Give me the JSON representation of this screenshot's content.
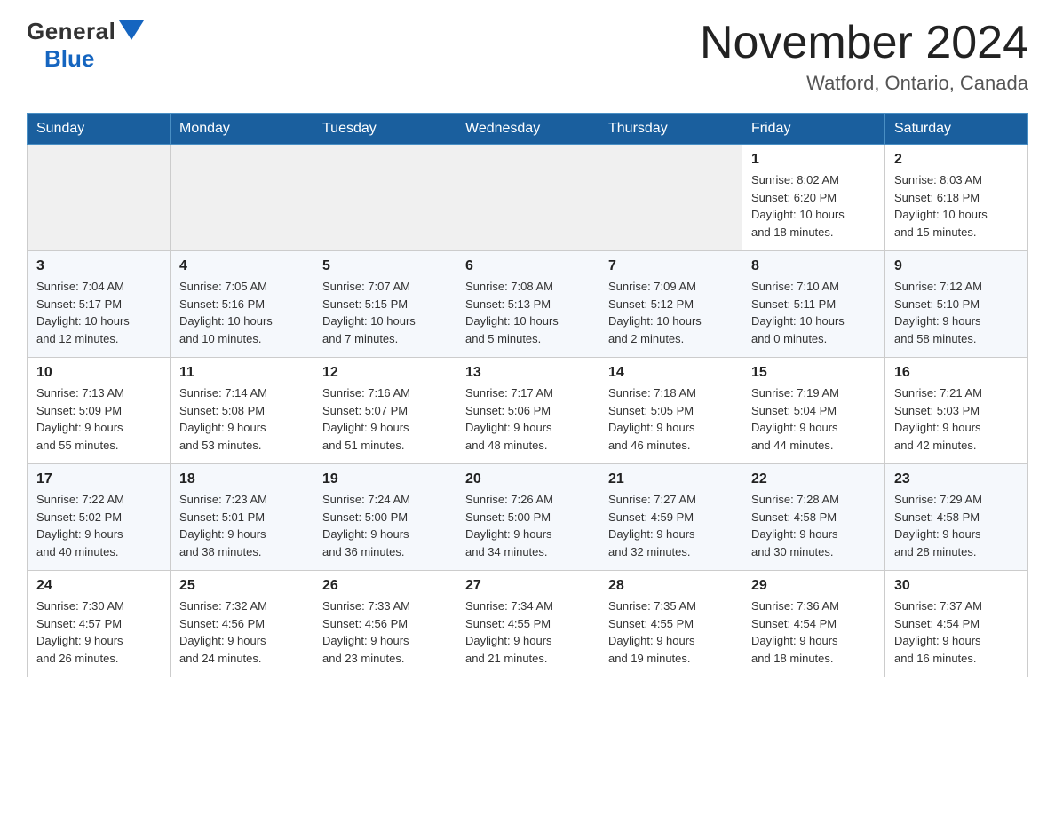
{
  "header": {
    "logo_general": "General",
    "logo_blue": "Blue",
    "month_title": "November 2024",
    "location": "Watford, Ontario, Canada"
  },
  "weekdays": [
    "Sunday",
    "Monday",
    "Tuesday",
    "Wednesday",
    "Thursday",
    "Friday",
    "Saturday"
  ],
  "weeks": [
    [
      {
        "day": "",
        "info": ""
      },
      {
        "day": "",
        "info": ""
      },
      {
        "day": "",
        "info": ""
      },
      {
        "day": "",
        "info": ""
      },
      {
        "day": "",
        "info": ""
      },
      {
        "day": "1",
        "info": "Sunrise: 8:02 AM\nSunset: 6:20 PM\nDaylight: 10 hours\nand 18 minutes."
      },
      {
        "day": "2",
        "info": "Sunrise: 8:03 AM\nSunset: 6:18 PM\nDaylight: 10 hours\nand 15 minutes."
      }
    ],
    [
      {
        "day": "3",
        "info": "Sunrise: 7:04 AM\nSunset: 5:17 PM\nDaylight: 10 hours\nand 12 minutes."
      },
      {
        "day": "4",
        "info": "Sunrise: 7:05 AM\nSunset: 5:16 PM\nDaylight: 10 hours\nand 10 minutes."
      },
      {
        "day": "5",
        "info": "Sunrise: 7:07 AM\nSunset: 5:15 PM\nDaylight: 10 hours\nand 7 minutes."
      },
      {
        "day": "6",
        "info": "Sunrise: 7:08 AM\nSunset: 5:13 PM\nDaylight: 10 hours\nand 5 minutes."
      },
      {
        "day": "7",
        "info": "Sunrise: 7:09 AM\nSunset: 5:12 PM\nDaylight: 10 hours\nand 2 minutes."
      },
      {
        "day": "8",
        "info": "Sunrise: 7:10 AM\nSunset: 5:11 PM\nDaylight: 10 hours\nand 0 minutes."
      },
      {
        "day": "9",
        "info": "Sunrise: 7:12 AM\nSunset: 5:10 PM\nDaylight: 9 hours\nand 58 minutes."
      }
    ],
    [
      {
        "day": "10",
        "info": "Sunrise: 7:13 AM\nSunset: 5:09 PM\nDaylight: 9 hours\nand 55 minutes."
      },
      {
        "day": "11",
        "info": "Sunrise: 7:14 AM\nSunset: 5:08 PM\nDaylight: 9 hours\nand 53 minutes."
      },
      {
        "day": "12",
        "info": "Sunrise: 7:16 AM\nSunset: 5:07 PM\nDaylight: 9 hours\nand 51 minutes."
      },
      {
        "day": "13",
        "info": "Sunrise: 7:17 AM\nSunset: 5:06 PM\nDaylight: 9 hours\nand 48 minutes."
      },
      {
        "day": "14",
        "info": "Sunrise: 7:18 AM\nSunset: 5:05 PM\nDaylight: 9 hours\nand 46 minutes."
      },
      {
        "day": "15",
        "info": "Sunrise: 7:19 AM\nSunset: 5:04 PM\nDaylight: 9 hours\nand 44 minutes."
      },
      {
        "day": "16",
        "info": "Sunrise: 7:21 AM\nSunset: 5:03 PM\nDaylight: 9 hours\nand 42 minutes."
      }
    ],
    [
      {
        "day": "17",
        "info": "Sunrise: 7:22 AM\nSunset: 5:02 PM\nDaylight: 9 hours\nand 40 minutes."
      },
      {
        "day": "18",
        "info": "Sunrise: 7:23 AM\nSunset: 5:01 PM\nDaylight: 9 hours\nand 38 minutes."
      },
      {
        "day": "19",
        "info": "Sunrise: 7:24 AM\nSunset: 5:00 PM\nDaylight: 9 hours\nand 36 minutes."
      },
      {
        "day": "20",
        "info": "Sunrise: 7:26 AM\nSunset: 5:00 PM\nDaylight: 9 hours\nand 34 minutes."
      },
      {
        "day": "21",
        "info": "Sunrise: 7:27 AM\nSunset: 4:59 PM\nDaylight: 9 hours\nand 32 minutes."
      },
      {
        "day": "22",
        "info": "Sunrise: 7:28 AM\nSunset: 4:58 PM\nDaylight: 9 hours\nand 30 minutes."
      },
      {
        "day": "23",
        "info": "Sunrise: 7:29 AM\nSunset: 4:58 PM\nDaylight: 9 hours\nand 28 minutes."
      }
    ],
    [
      {
        "day": "24",
        "info": "Sunrise: 7:30 AM\nSunset: 4:57 PM\nDaylight: 9 hours\nand 26 minutes."
      },
      {
        "day": "25",
        "info": "Sunrise: 7:32 AM\nSunset: 4:56 PM\nDaylight: 9 hours\nand 24 minutes."
      },
      {
        "day": "26",
        "info": "Sunrise: 7:33 AM\nSunset: 4:56 PM\nDaylight: 9 hours\nand 23 minutes."
      },
      {
        "day": "27",
        "info": "Sunrise: 7:34 AM\nSunset: 4:55 PM\nDaylight: 9 hours\nand 21 minutes."
      },
      {
        "day": "28",
        "info": "Sunrise: 7:35 AM\nSunset: 4:55 PM\nDaylight: 9 hours\nand 19 minutes."
      },
      {
        "day": "29",
        "info": "Sunrise: 7:36 AM\nSunset: 4:54 PM\nDaylight: 9 hours\nand 18 minutes."
      },
      {
        "day": "30",
        "info": "Sunrise: 7:37 AM\nSunset: 4:54 PM\nDaylight: 9 hours\nand 16 minutes."
      }
    ]
  ]
}
